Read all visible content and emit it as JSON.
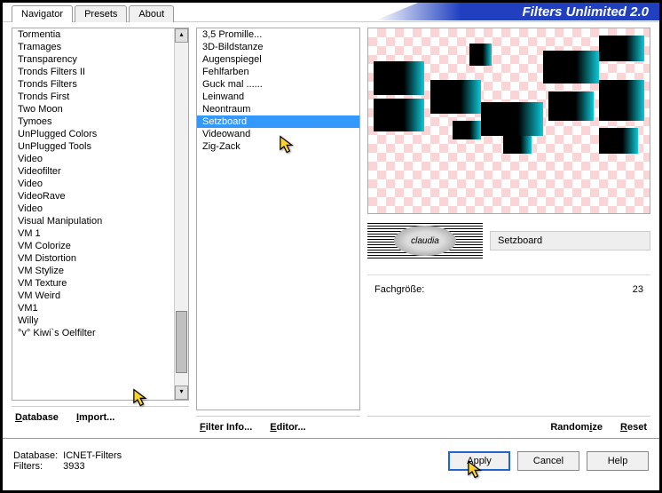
{
  "app_title": "Filters Unlimited 2.0",
  "tabs": [
    {
      "label": "Navigator",
      "active": true
    },
    {
      "label": "Presets",
      "active": false
    },
    {
      "label": "About",
      "active": false
    }
  ],
  "categories": [
    "Tormentia",
    "Tramages",
    "Transparency",
    "Tronds Filters II",
    "Tronds Filters",
    "Tronds First",
    "Two Moon",
    "Tymoes",
    "UnPlugged Colors",
    "UnPlugged Tools",
    "Video",
    "Videofilter",
    "Video",
    "VideoRave",
    "Video",
    "Visual Manipulation",
    "VM 1",
    "VM Colorize",
    "VM Distortion",
    "VM Stylize",
    "VM Texture",
    "VM Weird",
    "VM1",
    "Willy",
    "°v° Kiwi`s Oelfilter"
  ],
  "category_selected_index": 24,
  "filters": [
    "3,5 Promille...",
    "3D-Bildstanze",
    "Augenspiegel",
    "Fehlfarben",
    "Guck mal ......",
    "Leinwand",
    "Neontraum",
    "Setzboard",
    "Videowand",
    "Zig-Zack"
  ],
  "filter_selected_index": 7,
  "selected_filter_name": "Setzboard",
  "badge_text": "claudia",
  "params": [
    {
      "label": "Fachgröße:",
      "value": "23"
    }
  ],
  "toolbar": {
    "database": "Database",
    "import": "Import...",
    "filter_info": "Filter Info...",
    "editor": "Editor...",
    "randomize": "Randomize",
    "reset": "Reset"
  },
  "footer": {
    "db_label": "Database:",
    "db_value": "ICNET-Filters",
    "filters_label": "Filters:",
    "filters_value": "3933"
  },
  "buttons": {
    "apply": "Apply",
    "cancel": "Cancel",
    "help": "Help"
  }
}
